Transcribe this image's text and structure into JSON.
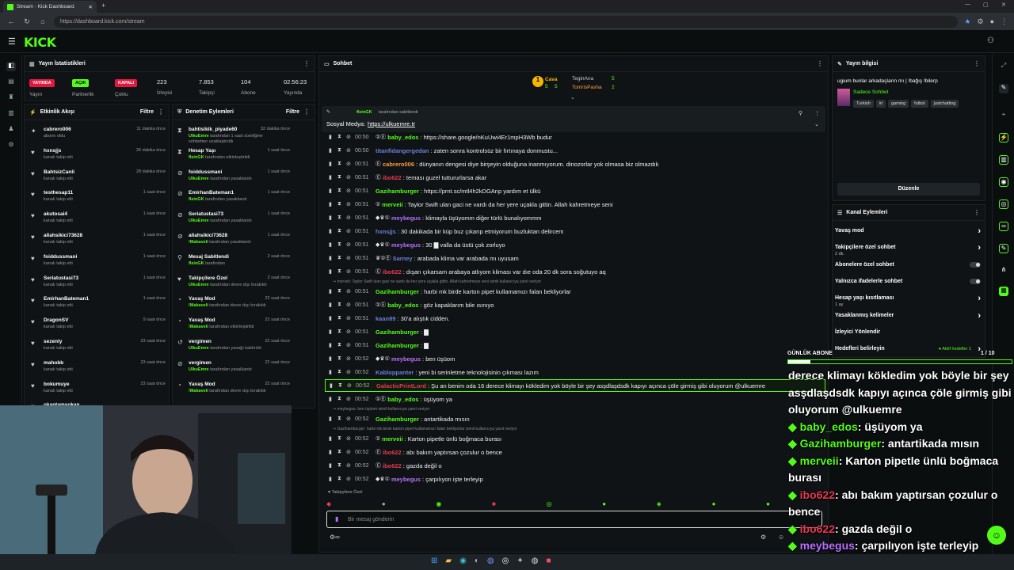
{
  "browser": {
    "tab_title": "Stream - Kick Dashboard",
    "url": "https://dashboard.kick.com/stream"
  },
  "logo": "KICK",
  "stats": {
    "title": "Yayın İstatistikleri",
    "badges": {
      "live": "YAYINDA",
      "open": "AÇIK",
      "closed": "KAPALI"
    },
    "labels": {
      "stream": "Yayın",
      "partner": "Partnerlik",
      "squad": "Çoklu",
      "viewers": "İzleyici",
      "followers": "Takipçi",
      "subs": "Abone",
      "duration": "Yayında"
    },
    "values": {
      "viewers": "223",
      "followers": "7.853",
      "subs": "104",
      "duration": "02:56:23"
    }
  },
  "activity": {
    "title": "Etkinlik Akışı",
    "filter": "Filtre",
    "items": [
      {
        "name": "cabrero006",
        "sub": "abone oldu",
        "time": "11 dakika önce",
        "icon": "star"
      },
      {
        "name": "hxnsjjs",
        "sub": "kanalı takip etti",
        "time": "26 dakika önce",
        "icon": "heart"
      },
      {
        "name": "BahtsizCanli",
        "sub": "kanalı takip etti",
        "time": "28 dakika önce",
        "icon": "heart"
      },
      {
        "name": "testhesap11",
        "sub": "kanalı takip etti",
        "time": "1 saat önce",
        "icon": "heart"
      },
      {
        "name": "akutosai4",
        "sub": "kanalı takip etti",
        "time": "1 saat önce",
        "icon": "heart"
      },
      {
        "name": "allahsikici73628",
        "sub": "kanalı takip etti",
        "time": "1 saat önce",
        "icon": "heart"
      },
      {
        "name": "foiddussmani",
        "sub": "kanalı takip etti",
        "time": "1 saat önce",
        "icon": "heart"
      },
      {
        "name": "Seriatustasi73",
        "sub": "kanalı takip etti",
        "time": "1 saat önce",
        "icon": "heart"
      },
      {
        "name": "EmirhanBateman1",
        "sub": "kanalı takip etti",
        "time": "1 saat önce",
        "icon": "heart"
      },
      {
        "name": "DragonSV",
        "sub": "kanalı takip etti",
        "time": "9 saat önce",
        "icon": "heart"
      },
      {
        "name": "sezenly",
        "sub": "kanalı takip etti",
        "time": "23 saat önce",
        "icon": "heart"
      },
      {
        "name": "mahobb",
        "sub": "kanalı takip etti",
        "time": "23 saat önce",
        "icon": "heart"
      },
      {
        "name": "bokumuye",
        "sub": "kanalı takip etti",
        "time": "23 saat önce",
        "icon": "heart"
      },
      {
        "name": "okantamsokan",
        "sub": "",
        "time": "",
        "icon": "heart"
      }
    ]
  },
  "moderation": {
    "title": "Denetim Eylemleri",
    "filter": "Filtre",
    "items": [
      {
        "name": "bahtisikik_piyade60",
        "actor": "UlkuEmre",
        "sub": " tarafından 1 saat süreliğine sohbetten uzaklaştırıldı",
        "time": "32 dakika önce",
        "icon": "hourglass"
      },
      {
        "name": "Hesap Yaşı",
        "actor": "fleinGK",
        "sub": " tarafından etkinleştirildi",
        "time": "1 saat önce",
        "icon": "hourglass"
      },
      {
        "name": "foiddussmani",
        "actor": "UlkuEmre",
        "sub": " tarafından yasaklandı",
        "time": "1 saat önce",
        "icon": "ban"
      },
      {
        "name": "EmirhanBateman1",
        "actor": "fleinGK",
        "sub": " tarafından yasaklandı",
        "time": "1 saat önce",
        "icon": "ban"
      },
      {
        "name": "Seriatustasi73",
        "actor": "UlkuEmre",
        "sub": " tarafından yasaklandı",
        "time": "1 saat önce",
        "icon": "ban"
      },
      {
        "name": "allahsikici73628",
        "actor": "!Makaveli",
        "sub": " tarafından yasaklandı",
        "time": "1 saat önce",
        "icon": "ban"
      },
      {
        "name": "Mesaj Sabitlendi",
        "actor": "fleinGK",
        "sub": " tarafından",
        "time": "2 saat önce",
        "icon": "pin"
      },
      {
        "name": "Takipçilere Özel",
        "actor": "UlkuEmre",
        "sub": " tarafından devre dışı bırakıldı",
        "time": "2 saat önce",
        "icon": "heart"
      },
      {
        "name": "Yavaş Mod",
        "actor": "!Makaveli",
        "sub": " tarafından devre dışı bırakıldı",
        "time": "22 saat önce",
        "icon": "slow"
      },
      {
        "name": "Yavaş Mod",
        "actor": "!Makaveli",
        "sub": " tarafından etkinleştirildi",
        "time": "22 saat önce",
        "icon": "slow"
      },
      {
        "name": "vergimen",
        "actor": "UlkuEmre",
        "sub": " tarafından yasağı kaldırıldı",
        "time": "22 saat önce",
        "icon": "undo"
      },
      {
        "name": "vergimen",
        "actor": "UlkuEmre",
        "sub": " tarafından yasaklandı",
        "time": "22 saat önce",
        "icon": "ban"
      },
      {
        "name": "Yavaş Mod",
        "actor": "!Makaveli",
        "sub": " tarafından devre dışı bırakıldı",
        "time": "22 saat önce",
        "icon": "slow"
      }
    ]
  },
  "chat": {
    "title": "Sohbet",
    "top_gifters": [
      {
        "name": "Cava",
        "count": "5",
        "sub": "5"
      },
      {
        "name": "TeginAna",
        "count": "5"
      },
      {
        "name": "TomrisPasha",
        "count": "2"
      }
    ],
    "pinned": {
      "by": "fleinGK",
      "by_suffix": "tarafından sabitlendi",
      "label": "Sosyal Medya:",
      "link": "https://ulkuemre.tr"
    },
    "messages": [
      {
        "time": "00:50",
        "user": "baby_edos",
        "color": "#53fc18",
        "badges": "①Ⓔ",
        "text": "https://share.google/nKuUwi4Er1mpH3Wb budur"
      },
      {
        "time": "00:50",
        "user": "titanfidangergedan",
        "color": "#6b7fd7",
        "badges": "",
        "text": "zaten sonra kontrolsüz bir fırtınaya donmustu..."
      },
      {
        "time": "00:51",
        "user": "cabrero006",
        "color": "#ff9d3c",
        "badges": "Ⓔ",
        "text": "dünyanın dengesi diye birşeyin olduğuna inanmıyorum. dinozorlar yok olmasa biz olmazdık"
      },
      {
        "time": "00:51",
        "user": "ibo622",
        "color": "#e63950",
        "badges": "Ⓔ",
        "text": "teması guzel tuttururlarsa akar"
      },
      {
        "time": "00:51",
        "user": "Gazihamburger",
        "color": "#53fc18",
        "badges": "",
        "text": "https://prnt.sc/mtl4h2kDGAnp yardım et ülkü"
      },
      {
        "time": "00:51",
        "user": "merveii",
        "color": "#53fc18",
        "badges": "①",
        "text": "Taylor Swift ulan gaci ne vardı da her yere uçakla gittin. Allah kahretmeye seni"
      },
      {
        "time": "00:51",
        "user": "meybegus",
        "color": "#b96fff",
        "badges": "◆♛①",
        "text": "klimayla üşüyomm diğer türlü bunalıyommm"
      },
      {
        "time": "00:51",
        "user": "hxnsjjs",
        "color": "#6b7fd7",
        "badges": "",
        "text": "30 dakikada bir küp buz çıkarıp etmiyorum buzluktan delircem"
      },
      {
        "time": "00:51",
        "user": "meybegus",
        "color": "#b96fff",
        "badges": "◆♛①",
        "text": "30 ▇ valla da üstü çok zorluyo"
      },
      {
        "time": "00:51",
        "user": "Sarney",
        "color": "#6b7fd7",
        "badges": "♛①Ⓔ",
        "text": "arabada klima var arabada mı uyusam"
      },
      {
        "time": "00:51",
        "user": "ibo622",
        "color": "#e63950",
        "badges": "Ⓔ",
        "text": "dışarı çıkarsam arabaya atlıyom kliması var dıe oda 20 dk sora soğutuyo aq"
      },
      {
        "time": "00:51",
        "user": "Gazihamburger",
        "color": "#53fc18",
        "badges": "",
        "text": "harbi mk birde karton pipet kullamamızı falan bekliyorlar",
        "reply": "merveii: Taylor Swift ulan gaci ne vardı da her yere uçakla gittin. Allah kahretmeye seni isimli kullanıcıya yanıt veriyor"
      },
      {
        "time": "00:51",
        "user": "baby_edos",
        "color": "#53fc18",
        "badges": "①Ⓔ",
        "text": "göz kapaklarım bile ısınıyo"
      },
      {
        "time": "00:51",
        "user": "kaan89",
        "color": "#6b7fd7",
        "badges": "",
        "text": "30'a alıştık cidden."
      },
      {
        "time": "00:51",
        "user": "Gazihamburger",
        "color": "#53fc18",
        "badges": "",
        "text": "▇"
      },
      {
        "time": "00:51",
        "user": "Gazihamburger",
        "color": "#53fc18",
        "badges": "",
        "text": "▇"
      },
      {
        "time": "00:52",
        "user": "meybegus",
        "color": "#b96fff",
        "badges": "◆♛①",
        "text": "ben üşüom"
      },
      {
        "time": "00:52",
        "user": "Kabloppanter",
        "color": "#6b7fd7",
        "badges": "",
        "text": "yeni bi serinletme teknolojisinin çıkması lazım"
      },
      {
        "time": "00:52",
        "user": "GalacticPrintLord",
        "color": "#e63950",
        "badges": "",
        "text": "Şu an benim oda 16 derece klimayı kökledim yok böyle bir şey asşdlaşdsdk kapıyı açınca çöle girmiş gibi oluyorum @ulkuemre",
        "highlight": true
      },
      {
        "time": "00:52",
        "user": "baby_edos",
        "color": "#53fc18",
        "badges": "①Ⓔ",
        "text": "üşüyom ya"
      },
      {
        "time": "00:52",
        "user": "Gazihamburger",
        "color": "#53fc18",
        "badges": "",
        "text": "antartikada mısın",
        "reply": "meybegus: ben üşüom isimli kullanıcıya yanıt veriyor"
      },
      {
        "time": "00:52",
        "user": "merveii",
        "color": "#53fc18",
        "badges": "①",
        "text": "Karton pipetle ünlü boğmaca burası",
        "reply": "Gazihamburger: harbi mk birde karton pipet kullamamızı falan bekliyorlar isimli kullanıcıya yanıt veriyor"
      },
      {
        "time": "00:52",
        "user": "ibo622",
        "color": "#e63950",
        "badges": "Ⓔ",
        "text": "abı bakım yaptırsan çozulur o bence"
      },
      {
        "time": "00:52",
        "user": "ibo622",
        "color": "#e63950",
        "badges": "Ⓔ",
        "text": "gazda değil o"
      },
      {
        "time": "00:52",
        "user": "meybegus",
        "color": "#b96fff",
        "badges": "◆♛①",
        "text": "çarpılıyon işte terleyip"
      }
    ],
    "followers_only_label": "Takipçilere Özel",
    "input_placeholder": "Bir mesaj gönderin"
  },
  "stream_info": {
    "title": "Yayın bilgisi",
    "stream_title": "ugium bunlar arkadaşların mı | !bağış !bilerp",
    "category": "Sadece Sohbet",
    "tags": [
      "Turkish",
      "irl",
      "gaming",
      "futbol",
      "justchatting"
    ],
    "edit_button": "Düzenle"
  },
  "channel_actions": {
    "title": "Kanal Eylemleri",
    "items": [
      {
        "label": "Yavaş mod",
        "sub": "",
        "control": "chevron"
      },
      {
        "label": "Takipçilere özel sohbet",
        "sub": "2 dk.",
        "control": "chevron"
      },
      {
        "label": "Abonelere özel sohbet",
        "sub": "",
        "control": "toggle"
      },
      {
        "label": "Yalnızca ifadelerle sohbet",
        "sub": "",
        "control": "toggle"
      },
      {
        "label": "Hesap yaşı kısıtlaması",
        "sub": "1 ay",
        "control": "chevron"
      },
      {
        "label": "Yasaklanmış kelimeler",
        "sub": "",
        "control": "chevron"
      },
      {
        "label": "İzleyici Yönlendir",
        "sub": "",
        "control": "none"
      },
      {
        "label": "Hedefleri belirleyin",
        "sub": "",
        "control": "chevron"
      }
    ],
    "goals_status": "Aktif hedefler",
    "goals_count": "1"
  },
  "overlay": {
    "sub_goal_label": "GÜNLÜK ABONE",
    "sub_goal_value": "1 / 10",
    "sub_goal_progress": 0.1,
    "lines": [
      {
        "user": "",
        "text": "derece klimayı kökledim yok böyle bir şey",
        "color": "#ffffff"
      },
      {
        "user": "",
        "text": "asşdlaşdsdk kapıyı açınca çöle girmiş gibi",
        "color": "#ffffff"
      },
      {
        "user": "",
        "text": "oluyorum @ulkuemre",
        "color": "#ffffff"
      },
      {
        "user": "baby_edos",
        "text": ": üşüyom ya",
        "color": "#53fc18"
      },
      {
        "user": "Gazihamburger",
        "text": ": antartikada mısın",
        "color": "#53fc18"
      },
      {
        "user": "merveii",
        "text": ": Karton pipetle ünlü boğmaca",
        "color": "#53fc18"
      },
      {
        "user": "",
        "text": "burası",
        "color": "#ffffff"
      },
      {
        "user": "ibo622",
        "text": ": abı bakım yaptırsan çozulur o",
        "color": "#e63950"
      },
      {
        "user": "",
        "text": "bence",
        "color": "#ffffff"
      },
      {
        "user": "ibo622",
        "text": ": gazda değil o",
        "color": "#e63950"
      },
      {
        "user": "meybegus",
        "text": ": çarpılıyon işte terleyip",
        "color": "#b96fff"
      }
    ]
  },
  "colors": {
    "kick_green": "#53fc18",
    "live_red": "#e5173f",
    "panel_bg": "#0f1315"
  }
}
